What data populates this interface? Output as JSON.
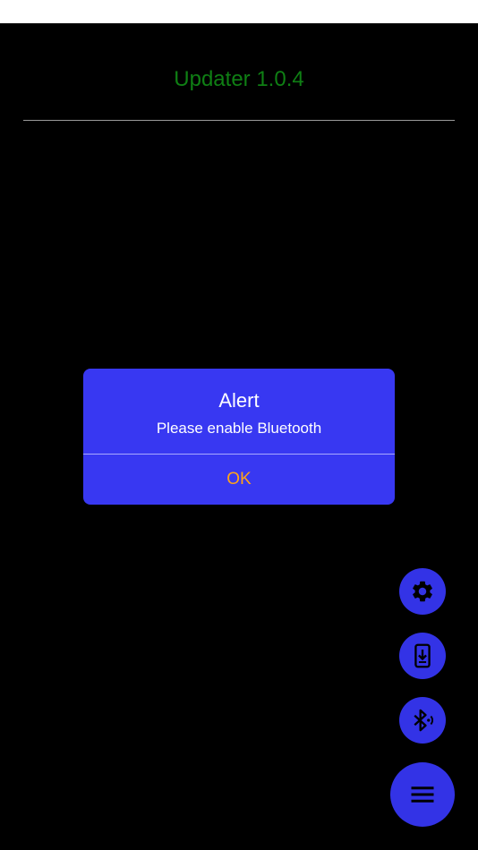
{
  "app": {
    "title": "Updater 1.0.4"
  },
  "alert": {
    "title": "Alert",
    "message": "Please enable Bluetooth",
    "ok_label": "OK"
  },
  "fabs": {
    "settings_icon": "gear-icon",
    "download_icon": "phone-download-icon",
    "bluetooth_icon": "bluetooth-audio-icon",
    "menu_icon": "hamburger-menu-icon"
  },
  "colors": {
    "background": "#000000",
    "title": "#0f7f14",
    "alert_background": "#3838f2",
    "alert_button": "#ffa31a",
    "fab": "#3333e6"
  }
}
